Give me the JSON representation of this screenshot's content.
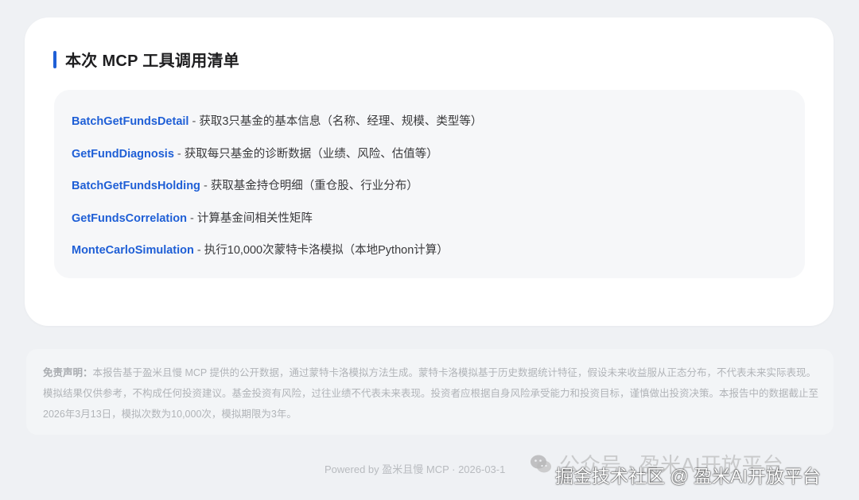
{
  "section": {
    "title": "本次 MCP 工具调用清单"
  },
  "tools": [
    {
      "name": "BatchGetFundsDetail",
      "sep": " - ",
      "desc": "获取3只基金的基本信息（名称、经理、规模、类型等）"
    },
    {
      "name": "GetFundDiagnosis",
      "sep": " - ",
      "desc": "获取每只基金的诊断数据（业绩、风险、估值等）"
    },
    {
      "name": "BatchGetFundsHolding",
      "sep": " - ",
      "desc": "获取基金持仓明细（重仓股、行业分布）"
    },
    {
      "name": "GetFundsCorrelation",
      "sep": " - ",
      "desc": "计算基金间相关性矩阵"
    },
    {
      "name": "MonteCarloSimulation",
      "sep": " - ",
      "desc": "执行10,000次蒙特卡洛模拟（本地Python计算）"
    }
  ],
  "disclaimer": {
    "label": "免责声明：",
    "text": "本报告基于盈米且慢 MCP 提供的公开数据，通过蒙特卡洛模拟方法生成。蒙特卡洛模拟基于历史数据统计特征，假设未来收益服从正态分布，不代表未来实际表现。模拟结果仅供参考，不构成任何投资建议。基金投资有风险，过往业绩不代表未来表现。投资者应根据自身风险承受能力和投资目标，谨慎做出投资决策。本报告中的数据截止至2026年3月13日，模拟次数为10,000次，模拟期限为3年。"
  },
  "footer": {
    "text": "Powered by 盈米且慢 MCP · 2026-03-1"
  },
  "watermark": {
    "top": "公众号 · 盈米AI开放平台",
    "bottom": "掘金技术社区 @ 盈米AI开放平台",
    "icon": "wechat-icon"
  },
  "colors": {
    "accent": "#1f5fd6",
    "background": "#eff1f4",
    "card": "#ffffff"
  }
}
